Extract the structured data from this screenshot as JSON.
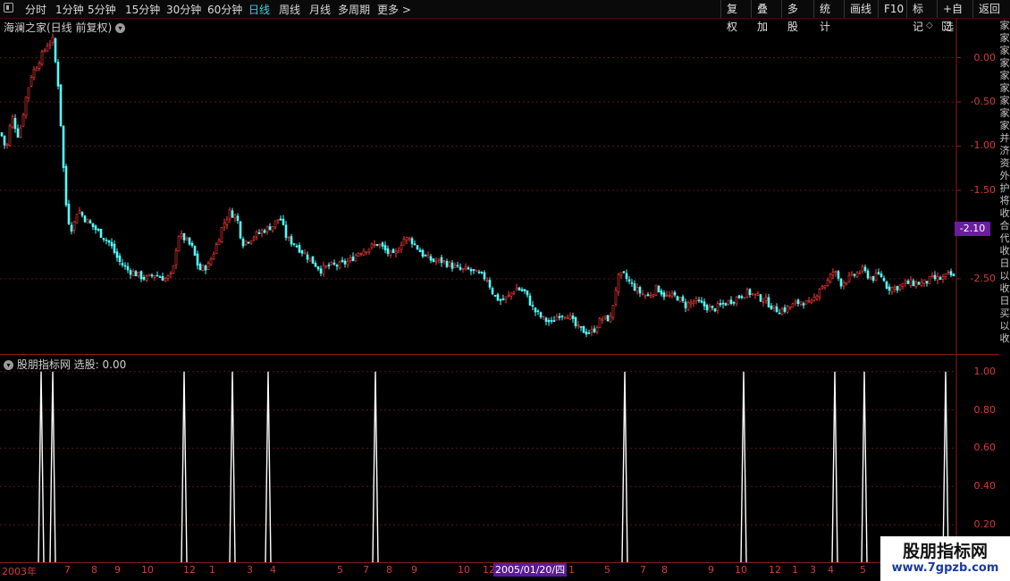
{
  "toolbar": {
    "periods": [
      "分时",
      "1分钟",
      "5分钟",
      "15分钟",
      "30分钟",
      "60分钟",
      "日线",
      "周线",
      "月线",
      "多周期",
      "更多 >"
    ],
    "active_period": "日线",
    "right_buttons": [
      "复权",
      "叠加",
      "多股",
      "统计",
      "画线",
      "F10",
      "标记",
      "+自选",
      "返回"
    ]
  },
  "main_panel": {
    "title": "海澜之家(日线 前复权)",
    "price_tag": "-2.10"
  },
  "indicator_panel": {
    "title": "股朋指标网",
    "select_label": "选股: 0.00"
  },
  "right_strip_chars": [
    "家",
    "家",
    "家",
    "家",
    "家",
    "家",
    "家",
    "家",
    "家",
    "并",
    "济",
    "资",
    "外",
    "护",
    "将",
    "收",
    "合",
    "代",
    "收",
    "日",
    "以",
    "收",
    "日",
    "买",
    "以",
    "收"
  ],
  "date_tag": "2005/01/20/四",
  "watermark": {
    "title": "股朋指标网",
    "url": "www.7gpzb.com"
  },
  "colors": {
    "up": "#ff3c3c",
    "down": "#54ffff",
    "axis": "#d23c3c",
    "signal": "#ffffff"
  },
  "chart_data": [
    {
      "type": "candlestick",
      "title": "海澜之家(日线 前复权)",
      "y_ticks": [
        0.0,
        -0.5,
        -1.0,
        -1.5,
        -2.5
      ],
      "ylim": [
        -3.35,
        0.45
      ],
      "current_value": -2.1,
      "approx_close_path": [
        [
          0,
          -0.85
        ],
        [
          6,
          -1.05
        ],
        [
          12,
          -0.65
        ],
        [
          20,
          -0.9
        ],
        [
          28,
          -0.45
        ],
        [
          34,
          -0.2
        ],
        [
          42,
          -0.05
        ],
        [
          52,
          0.15
        ],
        [
          58,
          0.2
        ],
        [
          64,
          -0.3
        ],
        [
          68,
          -0.9
        ],
        [
          72,
          -1.6
        ],
        [
          76,
          -1.85
        ],
        [
          80,
          -1.95
        ],
        [
          86,
          -1.7
        ],
        [
          92,
          -1.8
        ],
        [
          102,
          -1.9
        ],
        [
          112,
          -2.0
        ],
        [
          122,
          -2.1
        ],
        [
          132,
          -2.3
        ],
        [
          142,
          -2.4
        ],
        [
          152,
          -2.45
        ],
        [
          162,
          -2.5
        ],
        [
          172,
          -2.45
        ],
        [
          184,
          -2.5
        ],
        [
          192,
          -2.45
        ],
        [
          198,
          -2.0
        ],
        [
          206,
          -2.05
        ],
        [
          214,
          -2.15
        ],
        [
          222,
          -2.4
        ],
        [
          232,
          -2.35
        ],
        [
          240,
          -2.15
        ],
        [
          248,
          -1.9
        ],
        [
          256,
          -1.75
        ],
        [
          264,
          -1.8
        ],
        [
          270,
          -2.1
        ],
        [
          278,
          -2.05
        ],
        [
          286,
          -2.0
        ],
        [
          294,
          -1.95
        ],
        [
          304,
          -1.9
        ],
        [
          312,
          -1.8
        ],
        [
          320,
          -2.05
        ],
        [
          328,
          -2.1
        ],
        [
          338,
          -2.2
        ],
        [
          348,
          -2.3
        ],
        [
          358,
          -2.4
        ],
        [
          368,
          -2.35
        ],
        [
          378,
          -2.35
        ],
        [
          390,
          -2.3
        ],
        [
          400,
          -2.2
        ],
        [
          412,
          -2.15
        ],
        [
          422,
          -2.1
        ],
        [
          432,
          -2.2
        ],
        [
          440,
          -2.25
        ],
        [
          450,
          -2.05
        ],
        [
          458,
          -2.05
        ],
        [
          466,
          -2.15
        ],
        [
          474,
          -2.25
        ],
        [
          484,
          -2.3
        ],
        [
          494,
          -2.3
        ],
        [
          504,
          -2.35
        ],
        [
          514,
          -2.4
        ],
        [
          524,
          -2.4
        ],
        [
          534,
          -2.45
        ],
        [
          544,
          -2.5
        ],
        [
          552,
          -2.7
        ],
        [
          560,
          -2.75
        ],
        [
          568,
          -2.7
        ],
        [
          576,
          -2.6
        ],
        [
          586,
          -2.65
        ],
        [
          596,
          -2.85
        ],
        [
          606,
          -2.95
        ],
        [
          616,
          -3.0
        ],
        [
          624,
          -2.9
        ],
        [
          634,
          -2.9
        ],
        [
          644,
          -3.05
        ],
        [
          654,
          -3.1
        ],
        [
          662,
          -3.1
        ],
        [
          672,
          -2.95
        ],
        [
          682,
          -2.95
        ],
        [
          690,
          -2.5
        ],
        [
          696,
          -2.45
        ],
        [
          704,
          -2.55
        ],
        [
          714,
          -2.65
        ],
        [
          724,
          -2.7
        ],
        [
          734,
          -2.6
        ],
        [
          744,
          -2.7
        ],
        [
          756,
          -2.7
        ],
        [
          766,
          -2.8
        ],
        [
          776,
          -2.75
        ],
        [
          786,
          -2.8
        ],
        [
          796,
          -2.85
        ],
        [
          806,
          -2.8
        ],
        [
          816,
          -2.75
        ],
        [
          826,
          -2.7
        ],
        [
          836,
          -2.65
        ],
        [
          846,
          -2.7
        ],
        [
          856,
          -2.75
        ],
        [
          866,
          -2.85
        ],
        [
          876,
          -2.85
        ],
        [
          886,
          -2.8
        ],
        [
          896,
          -2.75
        ],
        [
          906,
          -2.8
        ],
        [
          916,
          -2.6
        ],
        [
          924,
          -2.55
        ],
        [
          932,
          -2.4
        ],
        [
          940,
          -2.55
        ],
        [
          948,
          -2.5
        ],
        [
          956,
          -2.45
        ],
        [
          964,
          -2.4
        ],
        [
          974,
          -2.5
        ],
        [
          984,
          -2.45
        ],
        [
          992,
          -2.6
        ],
        [
          1002,
          -2.6
        ],
        [
          1012,
          -2.55
        ],
        [
          1022,
          -2.55
        ],
        [
          1032,
          -2.55
        ],
        [
          1042,
          -2.5
        ],
        [
          1052,
          -2.5
        ],
        [
          1062,
          -2.45
        ],
        [
          1067,
          -2.5
        ]
      ]
    },
    {
      "type": "line",
      "title": "选股",
      "y_ticks": [
        1.0,
        0.8,
        0.6,
        0.4,
        0.2
      ],
      "ylim": [
        0,
        1.05
      ],
      "signal_values": [
        1,
        1,
        1,
        1,
        1,
        1,
        1,
        1,
        1,
        1,
        1,
        1
      ],
      "signal_positions": [
        46,
        59,
        206,
        260,
        300,
        420,
        699,
        832,
        934,
        967,
        1058
      ]
    }
  ],
  "date_axis_labels": [
    "2003年",
    "7",
    "8",
    "9",
    "10",
    "12",
    "1",
    "3",
    "4",
    "5",
    "7",
    "8",
    "9",
    "10",
    "12",
    "1",
    "5",
    "7",
    "8",
    "9",
    "10",
    "12",
    "1",
    "3",
    "4",
    "5",
    "7"
  ]
}
